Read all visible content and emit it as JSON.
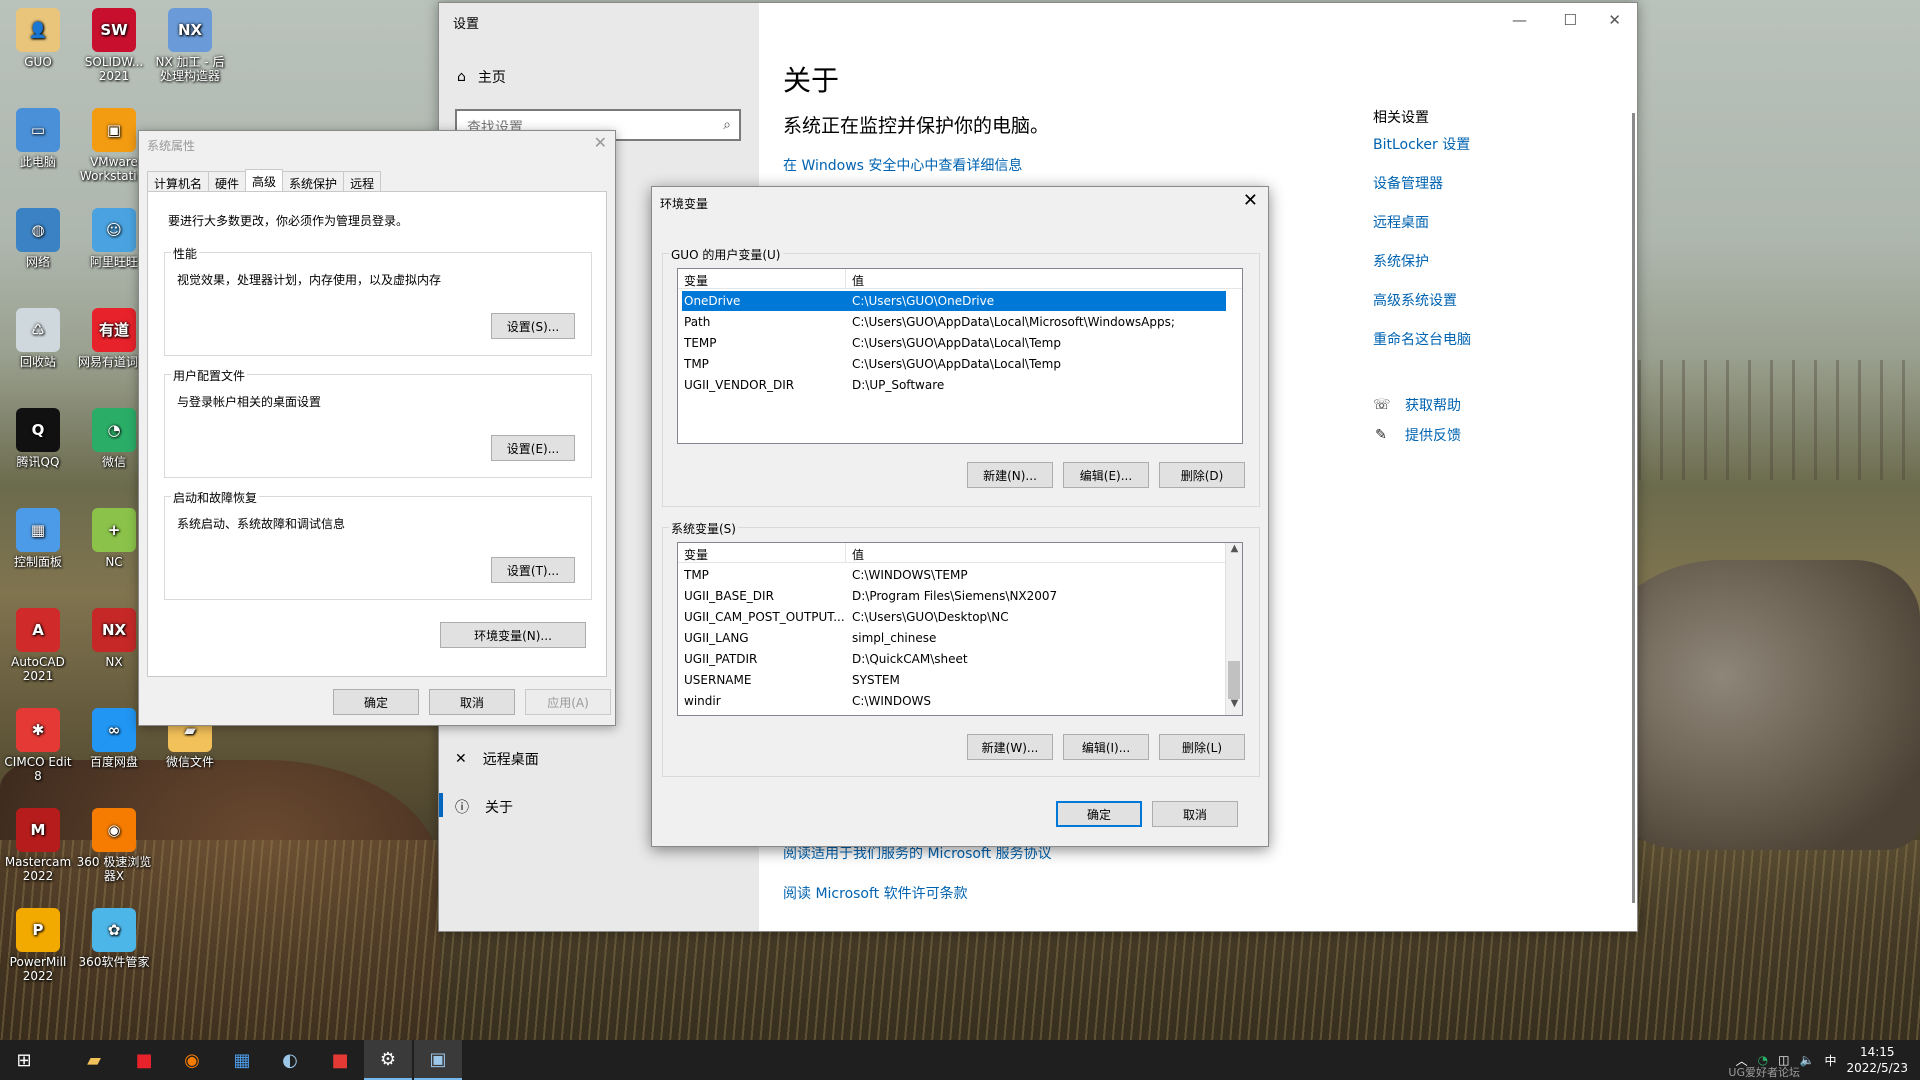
{
  "desktop_icons": [
    {
      "label": "GUO",
      "color": "#e8c57a",
      "glyph": "👤"
    },
    {
      "label": "SOLIDW... 2021",
      "color": "#c8102e",
      "glyph": "SW"
    },
    {
      "label": "NX 加工 - 后处理构造器",
      "color": "#6a9bd8",
      "glyph": "NX"
    },
    {
      "label": "此电脑",
      "color": "#4a90d9",
      "glyph": "▭"
    },
    {
      "label": "VMware Workstati...",
      "color": "#f39c12",
      "glyph": "▣"
    },
    {
      "label": "网络",
      "color": "#3b82c4",
      "glyph": "◍"
    },
    {
      "label": "阿里旺旺",
      "color": "#4aa3e0",
      "glyph": "☺"
    },
    {
      "label": "回收站",
      "color": "#cfd8dc",
      "glyph": "♺"
    },
    {
      "label": "网易有道词典",
      "color": "#e8222b",
      "glyph": "有道"
    },
    {
      "label": "腾讯QQ",
      "color": "#111111",
      "glyph": "Q"
    },
    {
      "label": "微信",
      "color": "#2aae67",
      "glyph": "◔"
    },
    {
      "label": "控制面板",
      "color": "#4c9be8",
      "glyph": "▦"
    },
    {
      "label": "NC",
      "color": "#8bc34a",
      "glyph": "+"
    },
    {
      "label": "AutoCAD 2021",
      "color": "#d02a2a",
      "glyph": "A"
    },
    {
      "label": "NX",
      "color": "#c62828",
      "glyph": "NX"
    },
    {
      "label": "CIMCO Edit 8",
      "color": "#e53935",
      "glyph": "✱"
    },
    {
      "label": "百度网盘",
      "color": "#2196f3",
      "glyph": "∞"
    },
    {
      "label": "微信文件",
      "color": "#f3c15a",
      "glyph": "▰"
    },
    {
      "label": "Mastercam 2022",
      "color": "#b71c1c",
      "glyph": "M"
    },
    {
      "label": "360 极速浏览器X",
      "color": "#f57c00",
      "glyph": "◉"
    },
    {
      "label": "PowerMill 2022",
      "color": "#f2a900",
      "glyph": "P"
    },
    {
      "label": "360软件管家",
      "color": "#4db6e8",
      "glyph": "✿"
    }
  ],
  "settings": {
    "title": "设置",
    "home": "主页",
    "search_placeholder": "查找设置",
    "nav_remote": "远程桌面",
    "nav_about": "关于",
    "heading": "关于",
    "subheading": "系统正在监控并保护你的电脑。",
    "security_link": "在 Windows 安全中心中查看详细信息",
    "ms_agreement_link": "阅读适用于我们服务的 Microsoft 服务协议",
    "ms_license_link": "阅读 Microsoft 软件许可条款",
    "related_title": "相关设置",
    "related_links": [
      "BitLocker 设置",
      "设备管理器",
      "远程桌面",
      "系统保护",
      "高级系统设置",
      "重命名这台电脑"
    ],
    "get_help": "获取帮助",
    "feedback": "提供反馈",
    "controls": {
      "min": "—",
      "max": "☐",
      "close": "✕"
    }
  },
  "sysprop": {
    "title": "系统属性",
    "tabs": [
      "计算机名",
      "硬件",
      "高级",
      "系统保护",
      "远程"
    ],
    "selected_tab": "高级",
    "note": "要进行大多数更改，你必须作为管理员登录。",
    "groups": [
      {
        "label": "性能",
        "desc": "视觉效果，处理器计划，内存使用，以及虚拟内存",
        "button": "设置(S)..."
      },
      {
        "label": "用户配置文件",
        "desc": "与登录帐户相关的桌面设置",
        "button": "设置(E)..."
      },
      {
        "label": "启动和故障恢复",
        "desc": "系统启动、系统故障和调试信息",
        "button": "设置(T)..."
      }
    ],
    "env_button": "环境变量(N)...",
    "ok": "确定",
    "cancel": "取消",
    "apply": "应用(A)"
  },
  "envvars": {
    "title": "环境变量",
    "user_group_label": "GUO 的用户变量(U)",
    "system_group_label": "系统变量(S)",
    "col_var": "变量",
    "col_val": "值",
    "user_vars": [
      {
        "name": "OneDrive",
        "value": "C:\\Users\\GUO\\OneDrive",
        "selected": true
      },
      {
        "name": "Path",
        "value": "C:\\Users\\GUO\\AppData\\Local\\Microsoft\\WindowsApps;"
      },
      {
        "name": "TEMP",
        "value": "C:\\Users\\GUO\\AppData\\Local\\Temp"
      },
      {
        "name": "TMP",
        "value": "C:\\Users\\GUO\\AppData\\Local\\Temp"
      },
      {
        "name": "UGII_VENDOR_DIR",
        "value": "D:\\UP_Software"
      }
    ],
    "system_vars": [
      {
        "name": "TMP",
        "value": "C:\\WINDOWS\\TEMP"
      },
      {
        "name": "UGII_BASE_DIR",
        "value": "D:\\Program Files\\Siemens\\NX2007"
      },
      {
        "name": "UGII_CAM_POST_OUTPUT...",
        "value": "C:\\Users\\GUO\\Desktop\\NC"
      },
      {
        "name": "UGII_LANG",
        "value": "simpl_chinese"
      },
      {
        "name": "UGII_PATDIR",
        "value": "D:\\QuickCAM\\sheet"
      },
      {
        "name": "USERNAME",
        "value": "SYSTEM"
      },
      {
        "name": "windir",
        "value": "C:\\WINDOWS"
      }
    ],
    "user_buttons": [
      "新建(N)...",
      "编辑(E)...",
      "删除(D)"
    ],
    "system_buttons": [
      "新建(W)...",
      "编辑(I)...",
      "删除(L)"
    ],
    "ok": "确定",
    "cancel": "取消"
  },
  "taskbar": {
    "time": "14:15",
    "date": "2022/5/23",
    "ime": "中",
    "watermark": "UG爱好者论坛"
  }
}
